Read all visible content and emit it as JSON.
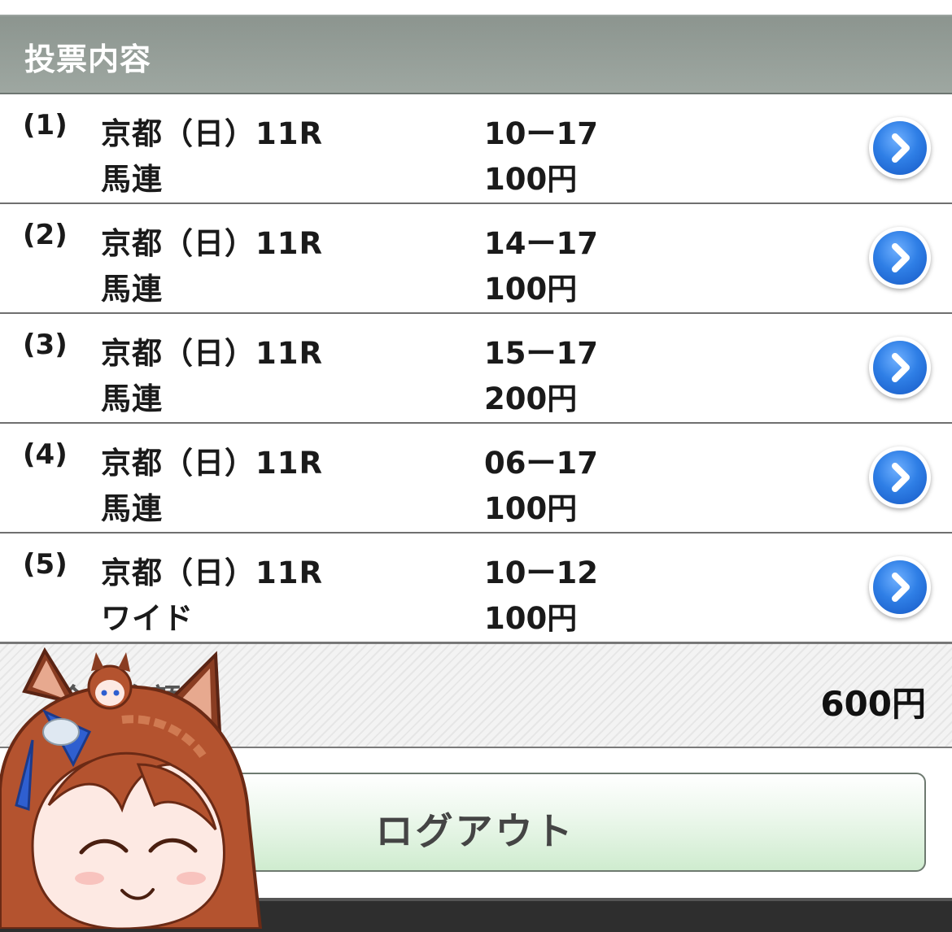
{
  "section": {
    "title": "投票内容"
  },
  "bets": [
    {
      "num": "(1)",
      "race": "京都（日）11R",
      "type": "馬連",
      "combo": "10ー17",
      "amount": "100円"
    },
    {
      "num": "(2)",
      "race": "京都（日）11R",
      "type": "馬連",
      "combo": "14ー17",
      "amount": "100円"
    },
    {
      "num": "(3)",
      "race": "京都（日）11R",
      "type": "馬連",
      "combo": "15ー17",
      "amount": "200円"
    },
    {
      "num": "(4)",
      "race": "京都（日）11R",
      "type": "馬連",
      "combo": "06ー17",
      "amount": "100円"
    },
    {
      "num": "(5)",
      "race": "京都（日）11R",
      "type": "ワイド",
      "combo": "10ー12",
      "amount": "100円"
    }
  ],
  "total": {
    "label": "合計金額",
    "amount": "600円"
  },
  "logout": {
    "label": "ログアウト"
  },
  "icons": {
    "detail": "chevron-right-circle-icon",
    "mascot": "horse-girl-sticker"
  },
  "colors": {
    "header_bg": "#8c958f",
    "button_blue": "#2f7fe6",
    "logout_green": "#cfeccf"
  }
}
